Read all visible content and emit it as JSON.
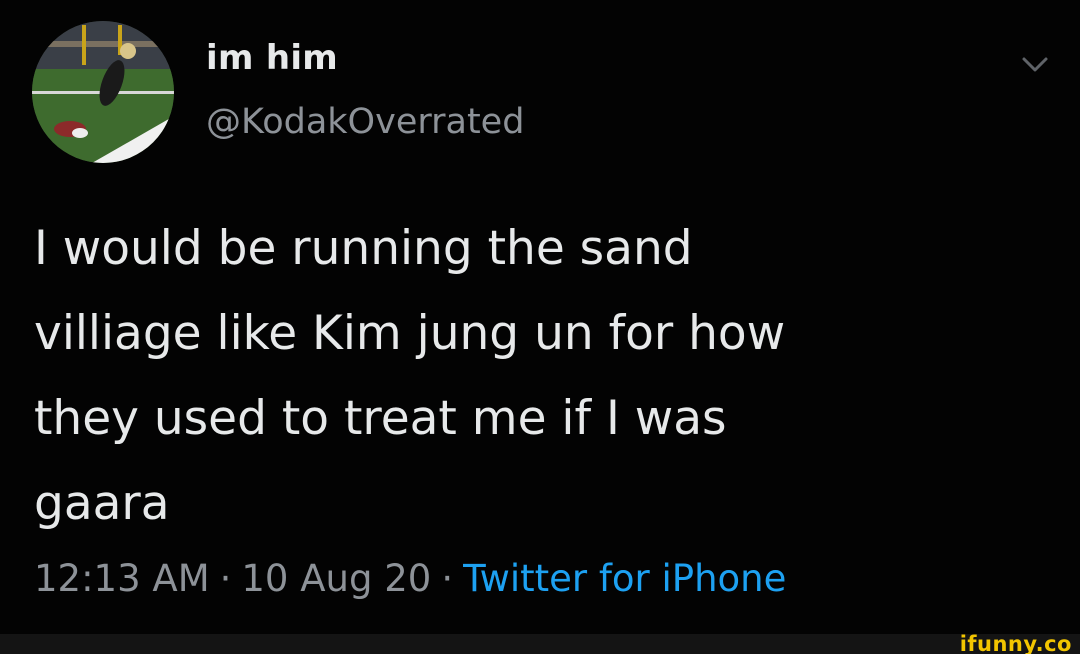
{
  "header": {
    "display_name": "im him",
    "handle": "@KodakOverrated"
  },
  "icons": {
    "avatar": "avatar-football-photo",
    "menu": "chevron-down-icon"
  },
  "tweet": {
    "lines": [
      "I would be running the sand",
      "villiage like Kim jung un for how",
      "they used to treat me if I was",
      "gaara"
    ]
  },
  "meta": {
    "time": "12:13 AM",
    "date": "10 Aug 20",
    "separator": "·",
    "source": "Twitter for iPhone"
  },
  "watermark": {
    "text": "ifunny.co"
  },
  "colors": {
    "background": "#030303",
    "text": "#e7e9ea",
    "muted": "#8d9298",
    "link": "#1da1f2",
    "watermark": "#f2c500"
  }
}
